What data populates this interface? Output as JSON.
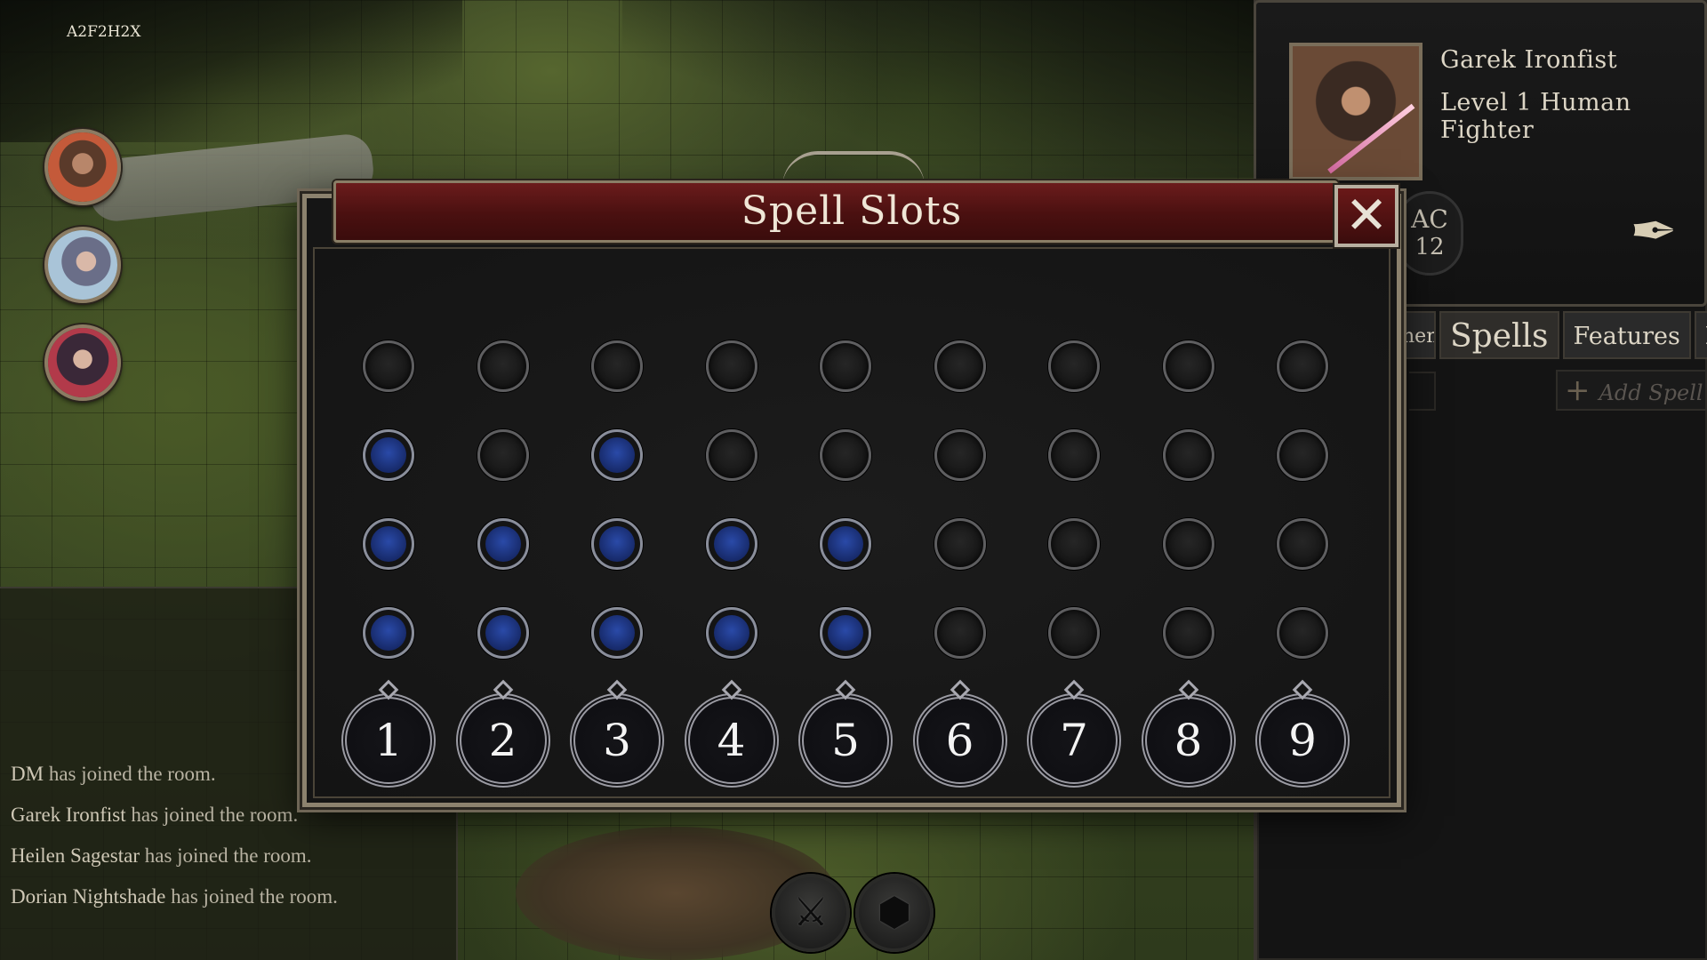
{
  "room_code": "A2F2H2X",
  "tokens": [
    {
      "name": "token-garek"
    },
    {
      "name": "token-heilen"
    },
    {
      "name": "token-dorian"
    }
  ],
  "chat": [
    {
      "actor": "DM",
      "text": " has joined the room."
    },
    {
      "actor": "Garek Ironfist",
      "text": " has joined the room."
    },
    {
      "actor": "Heilen Sagestar",
      "text": " has joined the room."
    },
    {
      "actor": "Dorian Nightshade",
      "text": " has joined the room."
    }
  ],
  "character": {
    "name": "Garek Ironfist",
    "class_line": "Level 1 Human Fighter",
    "ac_label": "AC",
    "ac_value": "12",
    "tabs": [
      "nent",
      "Spells",
      "Features",
      "NPC's"
    ],
    "active_tab": "Spells",
    "add_spell_label": "Add Spell"
  },
  "modal": {
    "title": "Spell Slots",
    "close_icon": "close-icon",
    "levels": [
      "1",
      "2",
      "3",
      "4",
      "5",
      "6",
      "7",
      "8",
      "9"
    ],
    "slots": [
      [
        false,
        false,
        false,
        false,
        false,
        false,
        false,
        false,
        false
      ],
      [
        true,
        false,
        true,
        false,
        false,
        false,
        false,
        false,
        false
      ],
      [
        true,
        true,
        true,
        true,
        true,
        false,
        false,
        false,
        false
      ],
      [
        true,
        true,
        true,
        true,
        true,
        false,
        false,
        false,
        false
      ]
    ],
    "colors": {
      "title_bar": "#5a1414",
      "slot_filled": "#1e3a8a",
      "frame": "#8c826e"
    }
  },
  "actions": [
    {
      "icon": "crossed-weapons-icon"
    },
    {
      "icon": "d20-dice-icon"
    }
  ]
}
